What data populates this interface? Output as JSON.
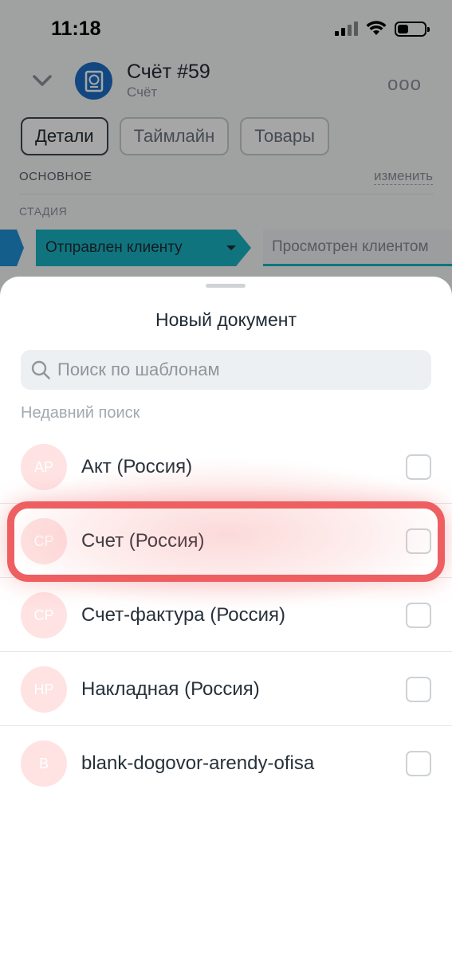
{
  "status_bar": {
    "time": "11:18"
  },
  "header": {
    "title": "Счёт #59",
    "subtitle": "Счёт",
    "more_label": "ooo"
  },
  "tabs": [
    {
      "label": "Детали",
      "active": true
    },
    {
      "label": "Таймлайн",
      "active": false
    },
    {
      "label": "Товары",
      "active": false
    }
  ],
  "section": {
    "label": "ОСНОВНОЕ",
    "edit_label": "изменить"
  },
  "stage": {
    "label": "СТАДИЯ",
    "current": "Отправлен клиенту",
    "next": "Просмотрен клиентом"
  },
  "sheet": {
    "title": "Новый документ",
    "search_placeholder": "Поиск по шаблонам",
    "recent_label": "Недавний поиск",
    "items": [
      {
        "initials": "AP",
        "label": "Акт (Россия)",
        "checked": false
      },
      {
        "initials": "CP",
        "label": "Счет (Россия)",
        "checked": false,
        "highlighted": true
      },
      {
        "initials": "CP",
        "label": "Счет-фактура (Россия)",
        "checked": false
      },
      {
        "initials": "HP",
        "label": "Накладная (Россия)",
        "checked": false
      },
      {
        "initials": "B",
        "label": "blank-dogovor-arendy-ofisa",
        "checked": false
      }
    ]
  },
  "colors": {
    "accent": "#17b3c2",
    "avatar_bg": "#ffe2e2",
    "highlight": "#ee5f62"
  }
}
